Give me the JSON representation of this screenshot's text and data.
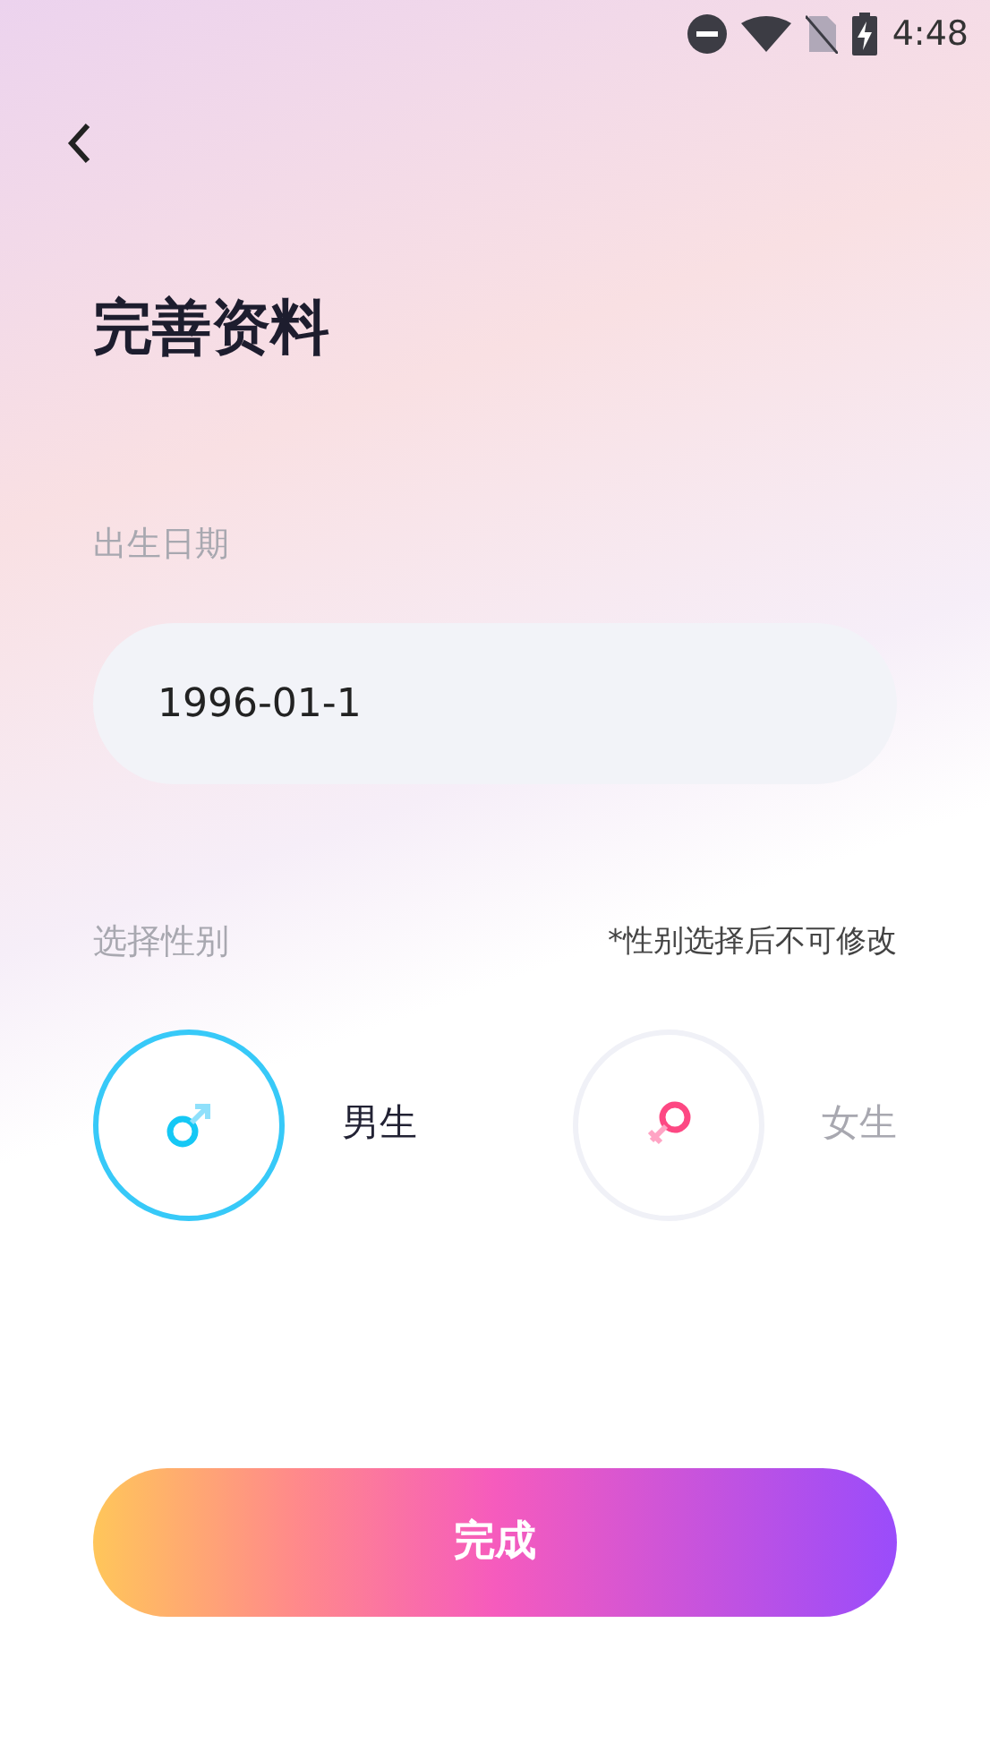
{
  "status_bar": {
    "time": "4:48"
  },
  "title": "完善资料",
  "birthdate": {
    "label": "出生日期",
    "value": "1996-01-1"
  },
  "gender": {
    "label": "选择性别",
    "note": "*性别选择后不可修改",
    "options": [
      {
        "kind": "male",
        "label": "男生",
        "selected": true
      },
      {
        "kind": "female",
        "label": "女生",
        "selected": false
      }
    ]
  },
  "submit": "完成"
}
